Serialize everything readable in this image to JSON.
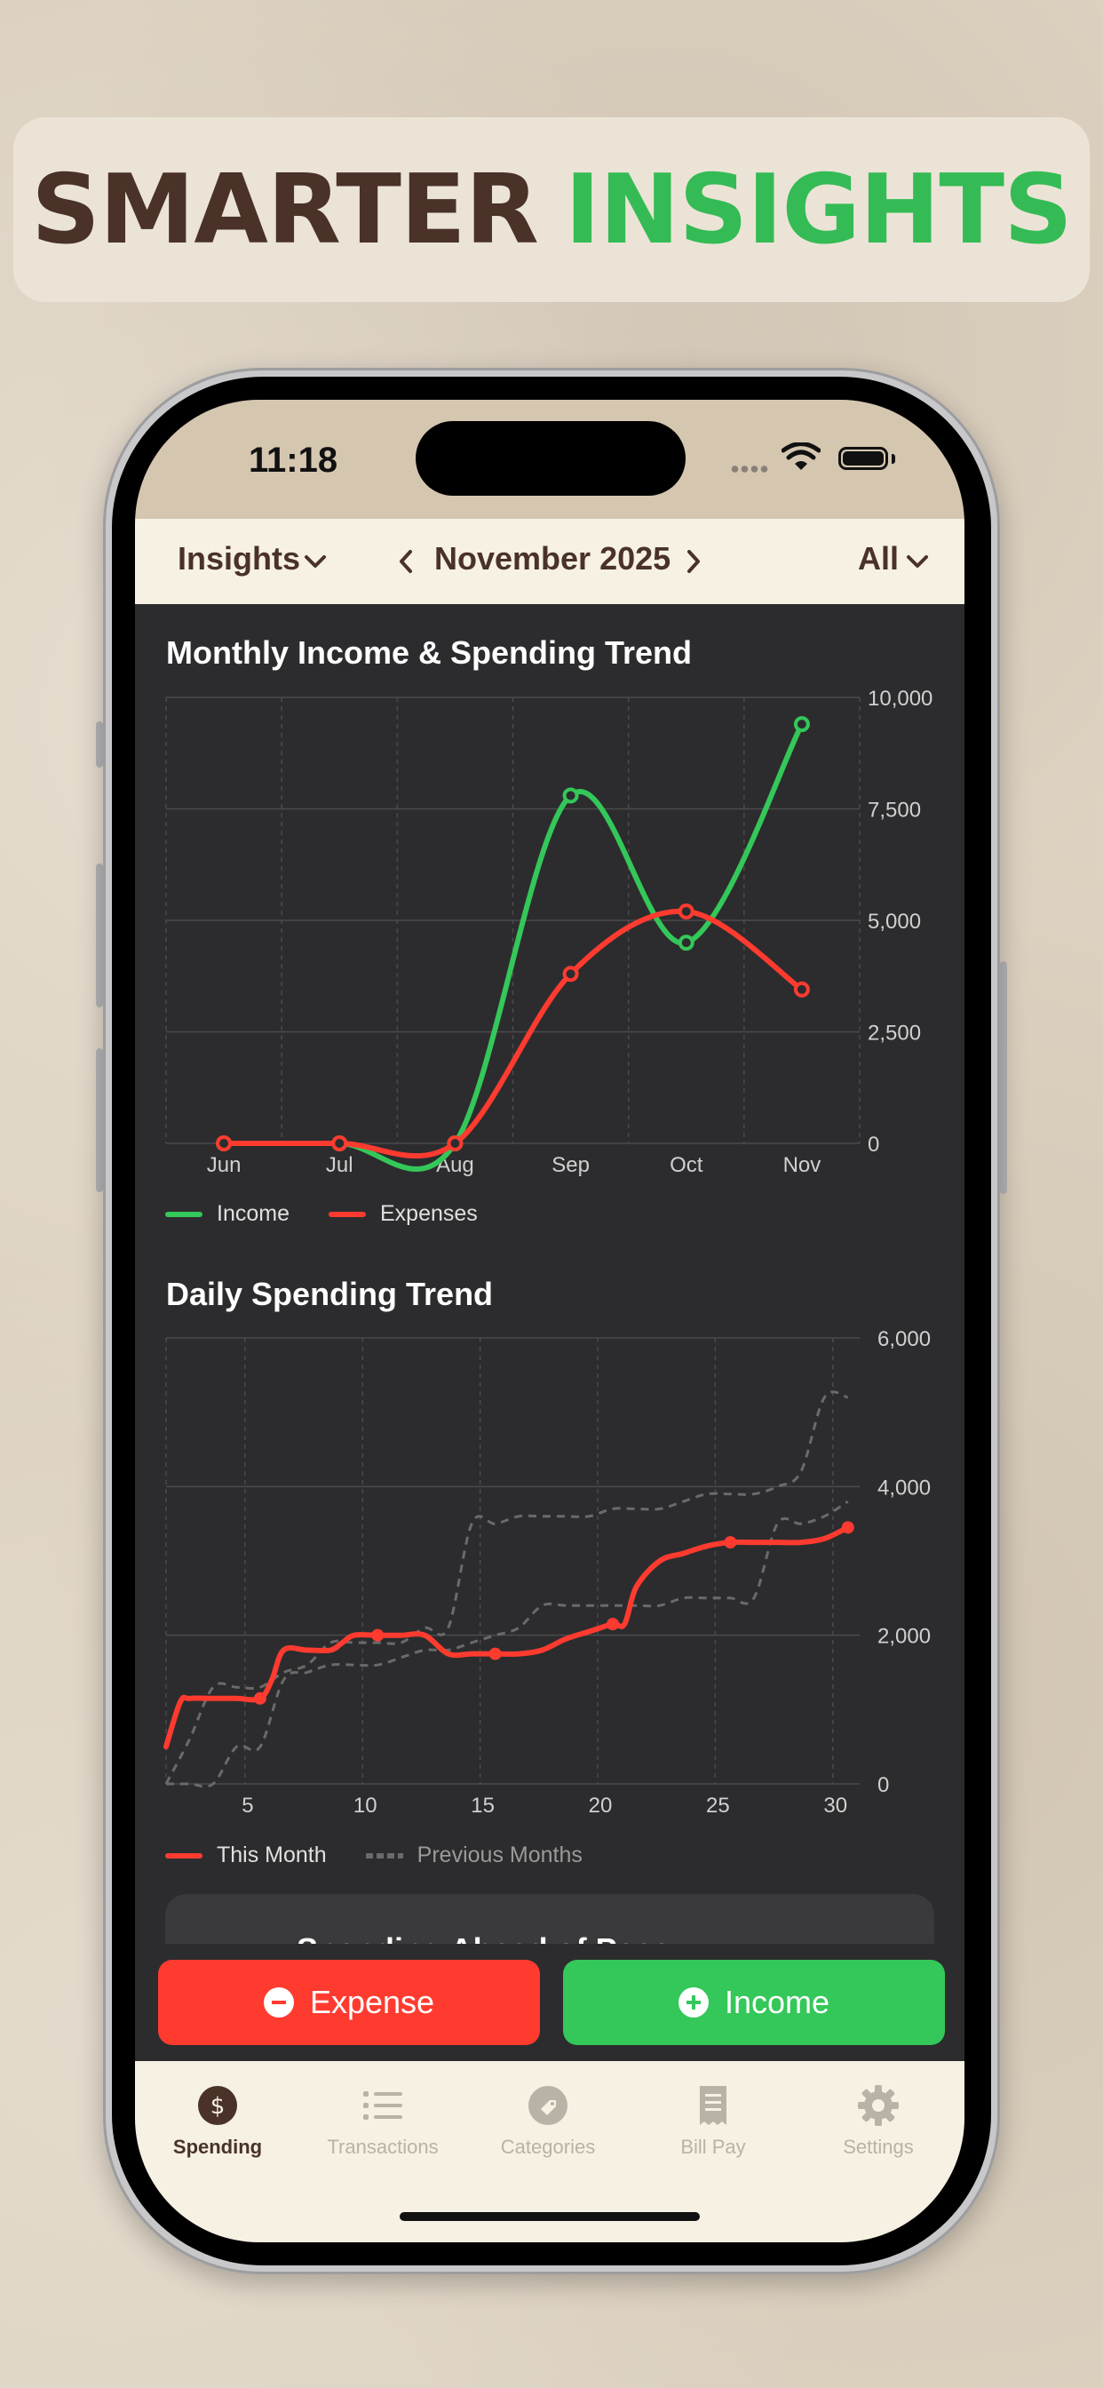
{
  "headline": {
    "word1": "SMARTER",
    "word2": "INSIGHTS"
  },
  "status": {
    "time": "11:18"
  },
  "nav": {
    "section": "Insights",
    "month": "November 2025",
    "filter": "All"
  },
  "monthly_chart": {
    "title": "Monthly Income & Spending Trend",
    "legend_income": "Income",
    "legend_expenses": "Expenses",
    "y_ticks": [
      "10,000",
      "7,500",
      "5,000",
      "2,500",
      "0"
    ],
    "x_ticks": [
      "Jun",
      "Jul",
      "Aug",
      "Sep",
      "Oct",
      "Nov"
    ]
  },
  "daily_chart": {
    "title": "Daily Spending Trend",
    "legend_this": "This Month",
    "legend_prev": "Previous Months",
    "y_ticks": [
      "6,000",
      "4,000",
      "2,000",
      "0"
    ],
    "x_ticks": [
      "5",
      "10",
      "15",
      "20",
      "25",
      "30"
    ]
  },
  "chart_data": [
    {
      "type": "line",
      "title": "Monthly Income & Spending Trend",
      "categories": [
        "Jun",
        "Jul",
        "Aug",
        "Sep",
        "Oct",
        "Nov"
      ],
      "series": [
        {
          "name": "Income",
          "color": "#34c759",
          "values": [
            0,
            0,
            0,
            7800,
            4500,
            9400
          ]
        },
        {
          "name": "Expenses",
          "color": "#ff3b30",
          "values": [
            0,
            0,
            0,
            3800,
            5200,
            3450
          ]
        }
      ],
      "ylim": [
        0,
        10000
      ],
      "y_ticks": [
        0,
        2500,
        5000,
        7500,
        10000
      ],
      "legend_position": "bottom-left",
      "grid": true
    },
    {
      "type": "line",
      "title": "Daily Spending Trend",
      "xlim": [
        1,
        30
      ],
      "ylim": [
        0,
        6000
      ],
      "x_ticks": [
        5,
        10,
        15,
        20,
        25,
        30
      ],
      "y_ticks": [
        0,
        2000,
        4000,
        6000
      ],
      "series": [
        {
          "name": "This Month",
          "color": "#ff3b30",
          "x": [
            1,
            1.6,
            2,
            3,
            4,
            5,
            5.5,
            6,
            7,
            8,
            8.5,
            9,
            10,
            11,
            12,
            13,
            14,
            15,
            16,
            17,
            18,
            19,
            20,
            20.5,
            21,
            22,
            23,
            24,
            25,
            26,
            27,
            28,
            29,
            30
          ],
          "y": [
            500,
            1100,
            1150,
            1150,
            1150,
            1150,
            1400,
            1800,
            1800,
            1800,
            1900,
            2000,
            2000,
            2000,
            2000,
            1750,
            1750,
            1750,
            1750,
            1800,
            1950,
            2050,
            2150,
            2150,
            2650,
            3000,
            3100,
            3200,
            3250,
            3250,
            3250,
            3250,
            3300,
            3450
          ],
          "markers_x": [
            5,
            10,
            15,
            20,
            25,
            30
          ]
        },
        {
          "name": "Previous Months",
          "color": "#6a6a6a",
          "style": "dashed",
          "x": [
            1,
            2,
            3,
            4,
            5,
            6,
            7,
            8,
            9,
            10,
            11,
            12,
            13,
            14,
            15,
            16,
            17,
            18,
            19,
            20,
            21,
            22,
            23,
            24,
            25,
            26,
            27,
            28,
            29,
            30
          ],
          "y": [
            0,
            600,
            1300,
            1300,
            1300,
            1500,
            1600,
            1900,
            1900,
            1900,
            1900,
            2100,
            2100,
            3500,
            3500,
            3600,
            3600,
            3600,
            3600,
            3700,
            3700,
            3700,
            3800,
            3900,
            3900,
            3900,
            4000,
            4200,
            5200,
            5200
          ]
        },
        {
          "name": "Previous Months",
          "color": "#6a6a6a",
          "style": "dashed",
          "x": [
            1,
            2,
            3,
            4,
            5,
            6,
            7,
            8,
            9,
            10,
            11,
            12,
            13,
            14,
            15,
            16,
            17,
            18,
            19,
            20,
            21,
            22,
            23,
            24,
            25,
            26,
            27,
            28,
            29,
            30
          ],
          "y": [
            0,
            0,
            0,
            500,
            500,
            1400,
            1500,
            1600,
            1600,
            1600,
            1700,
            1800,
            1800,
            1900,
            2000,
            2100,
            2400,
            2400,
            2400,
            2400,
            2400,
            2400,
            2500,
            2500,
            2500,
            2500,
            3500,
            3500,
            3600,
            3800
          ]
        }
      ],
      "legend_position": "bottom-left",
      "grid": true
    }
  ],
  "pace_card": {
    "title": "Spending Ahead of Pace"
  },
  "actions": {
    "expense": "Expense",
    "income": "Income"
  },
  "tabs": [
    {
      "label": "Spending",
      "icon": "dollar-icon",
      "active": true
    },
    {
      "label": "Transactions",
      "icon": "list-icon",
      "active": false
    },
    {
      "label": "Categories",
      "icon": "tag-icon",
      "active": false
    },
    {
      "label": "Bill Pay",
      "icon": "receipt-icon",
      "active": false
    },
    {
      "label": "Settings",
      "icon": "gear-icon",
      "active": false
    }
  ],
  "colors": {
    "brand_brown": "#4a3228",
    "brand_green": "#35bb55",
    "income": "#34c759",
    "expense": "#ff3b30",
    "screen_bg": "#2c2c2e",
    "bar_bg": "#f6f1e3"
  }
}
